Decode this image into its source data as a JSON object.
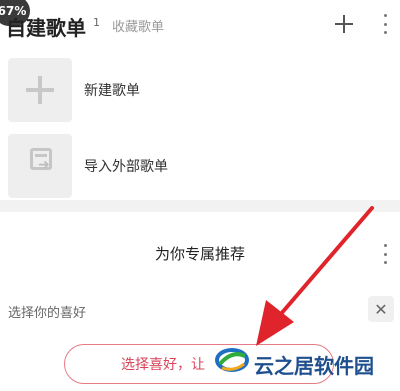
{
  "status": {
    "badge": "67%"
  },
  "header": {
    "title": "自建歌单",
    "count": "1",
    "collected_tab": "收藏歌单",
    "icons": {
      "add": "plus-icon",
      "more": "more-vertical-icon"
    }
  },
  "actions": [
    {
      "label": "新建歌单",
      "icon": "plus-icon"
    },
    {
      "label": "导入外部歌单",
      "icon": "import-icon"
    }
  ],
  "recommend": {
    "title": "为你专属推荐",
    "pref_label": "选择你的喜好",
    "close_symbol": "✕",
    "button_label": "选择喜好，让"
  },
  "watermark": {
    "text": "云之居软件园"
  },
  "colors": {
    "accent": "#d9445a",
    "annotation_arrow": "#e0242b",
    "watermark": "#1e4f8f"
  }
}
